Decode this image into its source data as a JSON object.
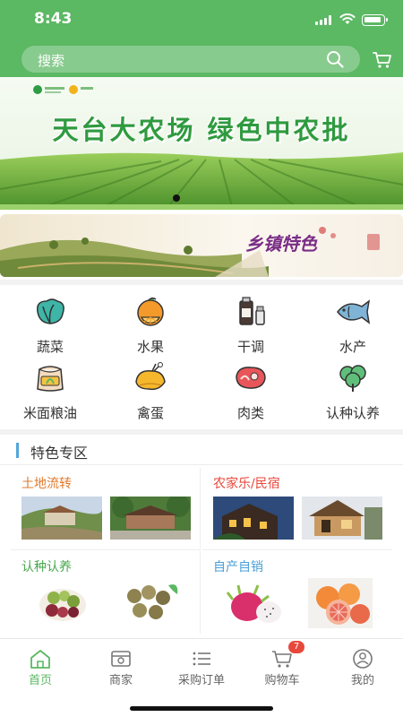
{
  "status_bar": {
    "time": "8:43"
  },
  "search": {
    "placeholder": "搜索"
  },
  "banner": {
    "title": "天台大农场 绿色中农批"
  },
  "banner2": {
    "text": "乡镇特色"
  },
  "categories": [
    {
      "label": "蔬菜",
      "icon": "cabbage-icon"
    },
    {
      "label": "水果",
      "icon": "orange-icon"
    },
    {
      "label": "干调",
      "icon": "condiment-icon"
    },
    {
      "label": "水产",
      "icon": "fish-icon"
    },
    {
      "label": "米面粮油",
      "icon": "rice-bag-icon"
    },
    {
      "label": "禽蛋",
      "icon": "chicken-icon"
    },
    {
      "label": "肉类",
      "icon": "meat-icon"
    },
    {
      "label": "认种认养",
      "icon": "tree-icon"
    }
  ],
  "special": {
    "title": "特色专区",
    "cards": [
      {
        "title": "土地流转",
        "color": "#e07a2f"
      },
      {
        "title": "农家乐/民宿",
        "color": "#e8483b"
      },
      {
        "title": "认种认养",
        "color": "#49a84f"
      },
      {
        "title": "自产自销",
        "color": "#4aa0d8"
      }
    ]
  },
  "tabbar": {
    "active_color": "#5bb863",
    "items": [
      {
        "label": "首页"
      },
      {
        "label": "商家"
      },
      {
        "label": "采购订单"
      },
      {
        "label": "购物车",
        "badge": "7"
      },
      {
        "label": "我的"
      }
    ]
  }
}
